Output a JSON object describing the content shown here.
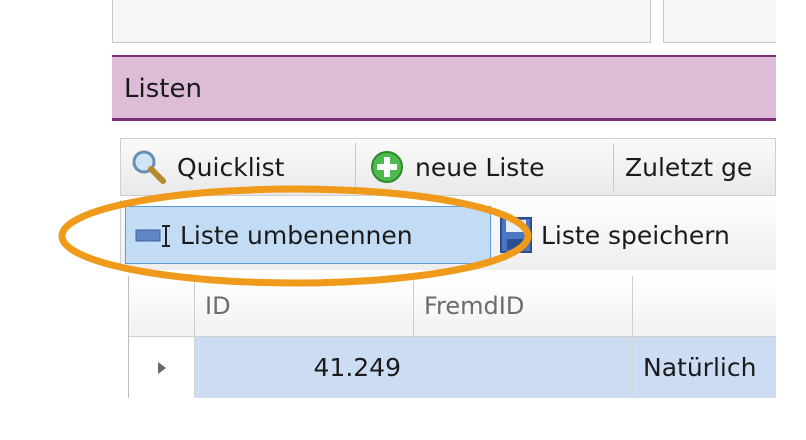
{
  "panel": {
    "title": "Listen"
  },
  "toolbar1": {
    "quicklist_label": "Quicklist",
    "new_list_label": "neue Liste",
    "recent_label": "Zuletzt ge"
  },
  "toolbar2": {
    "rename_label": "Liste umbenennen",
    "save_label": "Liste speichern"
  },
  "grid": {
    "columns": [
      "ID",
      "FremdID",
      ""
    ],
    "rows": [
      {
        "id": "41.249",
        "fremd_id": "",
        "name": "Natürlich"
      }
    ]
  },
  "colors": {
    "title_bar": "#dcbcd6",
    "title_border": "#7c2c78",
    "selected_row": "#ccdcf3",
    "highlight_ellipse": "#ef9a1a"
  }
}
